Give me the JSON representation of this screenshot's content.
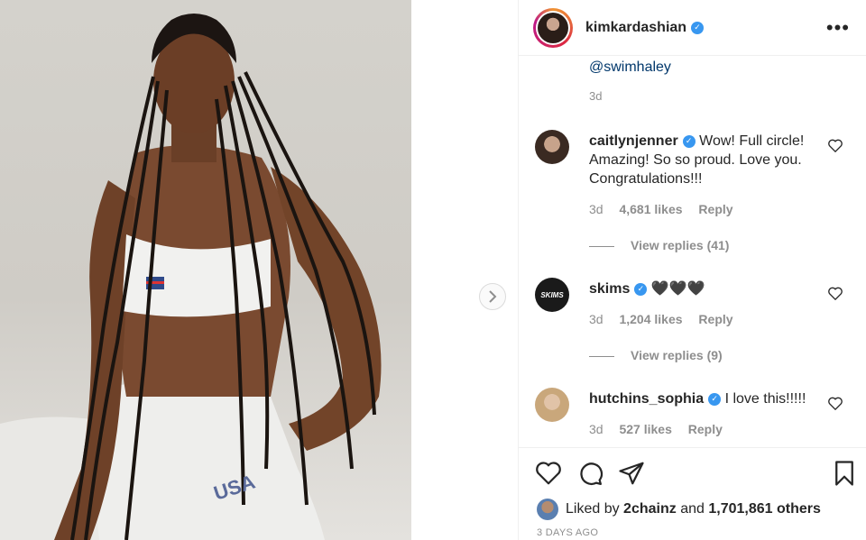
{
  "post": {
    "username": "kimkardashian",
    "more_icon": "more-horizontal-icon"
  },
  "caption": {
    "mention": "@swimhaley",
    "time": "3d"
  },
  "comments": [
    {
      "username": "caitlynjenner",
      "text": "Wow! Full circle! Amazing! So so proud. Love you. Congratulations!!!",
      "time": "3d",
      "likes": "4,681 likes",
      "reply": "Reply",
      "view_replies": "View replies (41)"
    },
    {
      "username": "skims",
      "text": "🖤🖤🖤",
      "avatar_text": "SKIMS",
      "time": "3d",
      "likes": "1,204 likes",
      "reply": "Reply",
      "view_replies": "View replies (9)"
    },
    {
      "username": "hutchins_sophia",
      "text": "I love this!!!!!",
      "time": "3d",
      "likes": "527 likes",
      "reply": "Reply"
    }
  ],
  "likes": {
    "prefix": "Liked by",
    "user": "2chainz",
    "and": "and",
    "count": "1,701,861 others"
  },
  "posted": "3 DAYS AGO",
  "colors": {
    "verified": "#3897f0",
    "mention": "#00376b",
    "muted": "#8e8e8e"
  }
}
